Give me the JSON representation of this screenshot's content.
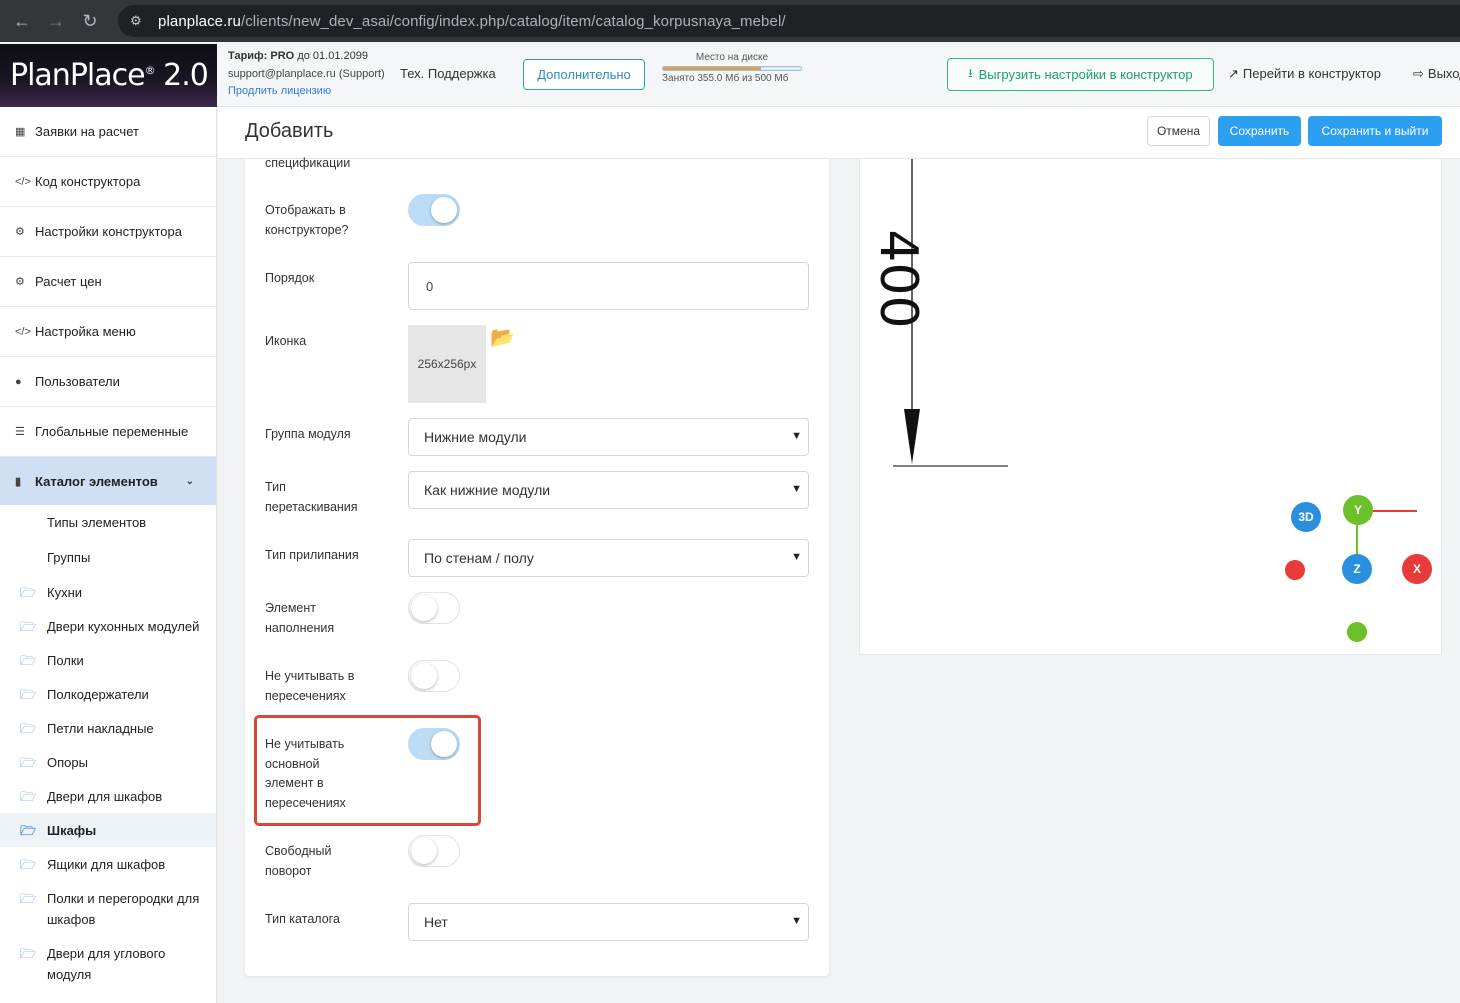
{
  "browser": {
    "url_host": "planplace.ru",
    "url_path": "/clients/new_dev_asai/config/index.php/catalog/item/catalog_korpusnaya_mebel/"
  },
  "header": {
    "logo": "PlanPlace",
    "logo_suffix": "2.0",
    "tariff_label": "Тариф:",
    "tariff_value": "PRO",
    "tariff_until": "до 01.01.2099",
    "support_email": "support@planplace.ru (Support)",
    "renew_link": "Продлить лицензию",
    "tech_support": "Тех. Поддержка",
    "more_button": "Дополнительно",
    "disk_title": "Место на диске",
    "disk_used": "Занято 355.0 Мб из 500 Мб",
    "disk_used_fraction": 0.71,
    "export_button": "Выгрузить настройки в конструктор",
    "goto_constructor": "Перейти в конструктор",
    "logout": "Выход"
  },
  "sidebar": {
    "items": [
      {
        "label": "Заявки на расчет",
        "icon": "file-icon"
      },
      {
        "label": "Код конструктора",
        "icon": "code-icon"
      },
      {
        "label": "Настройки конструктора",
        "icon": "gears-icon"
      },
      {
        "label": "Расчет цен",
        "icon": "gears-icon"
      },
      {
        "label": "Настройка меню",
        "icon": "code-icon"
      },
      {
        "label": "Пользователи",
        "icon": "user-icon"
      },
      {
        "label": "Глобальные переменные",
        "icon": "list-icon"
      }
    ],
    "active": {
      "label": "Каталог элементов",
      "icon": "book-icon"
    },
    "subitems": [
      "Типы элементов",
      "Группы"
    ],
    "folders": [
      {
        "label": "Кухни"
      },
      {
        "label": "Двери кухонных модулей"
      },
      {
        "label": "Полки"
      },
      {
        "label": "Полкодержатели"
      },
      {
        "label": "Петли накладные"
      },
      {
        "label": "Опоры"
      },
      {
        "label": "Двери для шкафов"
      },
      {
        "label": "Шкафы"
      },
      {
        "label": "Ящики для шкафов"
      },
      {
        "label": "Полки и перегородки для шкафов"
      },
      {
        "label": "Двери для углового модуля"
      }
    ]
  },
  "page": {
    "title": "Добавить",
    "cancel": "Отмена",
    "save": "Сохранить",
    "save_exit": "Сохранить и выйти"
  },
  "form": {
    "spec_label_tail": "спецификации",
    "show_in_constructor": {
      "label": "Отображать в конструкторе?",
      "on": true
    },
    "order": {
      "label": "Порядок",
      "value": "0"
    },
    "icon": {
      "label": "Иконка",
      "placeholder": "256x256px"
    },
    "module_group": {
      "label": "Группа модуля",
      "value": "Нижние модули"
    },
    "drag_type": {
      "label": "Тип перетаскивания",
      "value": "Как нижние модули"
    },
    "stick_type": {
      "label": "Тип прилипания",
      "value": "По стенам / полу"
    },
    "fill_element": {
      "label": "Элемент наполнения",
      "on": false
    },
    "ignore_intersections": {
      "label": "Не учитывать в пересечениях",
      "on": false
    },
    "ignore_main_intersections": {
      "label": "Не учитывать основной элемент в пересечениях",
      "on": true
    },
    "free_rotation": {
      "label": "Свободный поворот",
      "on": false
    },
    "catalog_type": {
      "label": "Тип каталога",
      "value": "Нет"
    }
  },
  "preview": {
    "dimension": "400",
    "axes": {
      "three_d": "3D",
      "x": "X",
      "y": "Y",
      "z": "Z"
    }
  },
  "colors": {
    "accent": "#2c9ff0",
    "export_green": "#1e9e6e",
    "highlight_red": "#d9463b",
    "axis_x": "#e83a3a",
    "axis_y": "#6cc02a",
    "axis_z": "#2b8fe0"
  }
}
